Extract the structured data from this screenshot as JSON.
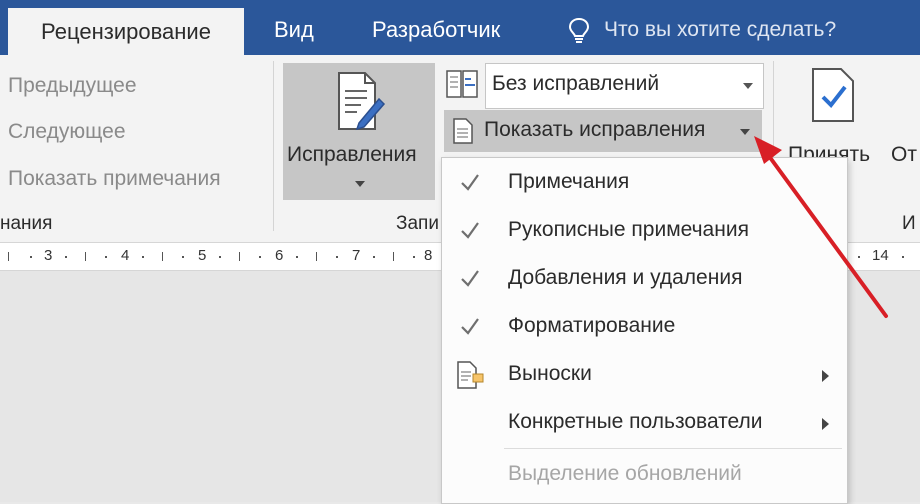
{
  "tabs": [
    {
      "label": "Рецензирование",
      "active": true
    },
    {
      "label": "Вид",
      "active": false
    },
    {
      "label": "Разработчик",
      "active": false
    }
  ],
  "tell_me": {
    "placeholder": "Что вы хотите сделать?",
    "icon": "lightbulb-icon"
  },
  "comments_group": {
    "previous": "Предыдущее",
    "next": "Следующее",
    "show_comments": "Показать примечания",
    "group_label_fragment": "нания"
  },
  "tracking_group": {
    "button_label": "Исправления",
    "markup_combo_value": "Без исправлений",
    "show_markup_label": "Показать исправления",
    "group_label_fragment": "Запи"
  },
  "changes_group": {
    "accept_label": "Принять",
    "reject_fragment": "От",
    "group_label_fragment": "И"
  },
  "ruler": {
    "numbers": [
      "3",
      "4",
      "5",
      "6",
      "7",
      "8",
      "14"
    ]
  },
  "menu": {
    "items": [
      {
        "label": "Примечания",
        "checked": true,
        "submenu": false,
        "disabled": false
      },
      {
        "label": "Рукописные примечания",
        "checked": true,
        "submenu": false,
        "disabled": false
      },
      {
        "label": "Добавления и удаления",
        "checked": true,
        "submenu": false,
        "disabled": false
      },
      {
        "label": "Форматирование",
        "checked": true,
        "submenu": false,
        "disabled": false
      },
      {
        "label": "Выноски",
        "checked": false,
        "submenu": true,
        "disabled": false,
        "icon": "balloons-icon"
      },
      {
        "label": "Конкретные пользователи",
        "checked": false,
        "submenu": true,
        "disabled": false
      },
      {
        "label": "Выделение обновлений",
        "checked": false,
        "submenu": false,
        "disabled": true
      }
    ]
  },
  "colors": {
    "tab_bar": "#2b579a",
    "ribbon": "#f3f3f3",
    "pointer_arrow": "#d81f26",
    "check": "#6f6f6f"
  }
}
